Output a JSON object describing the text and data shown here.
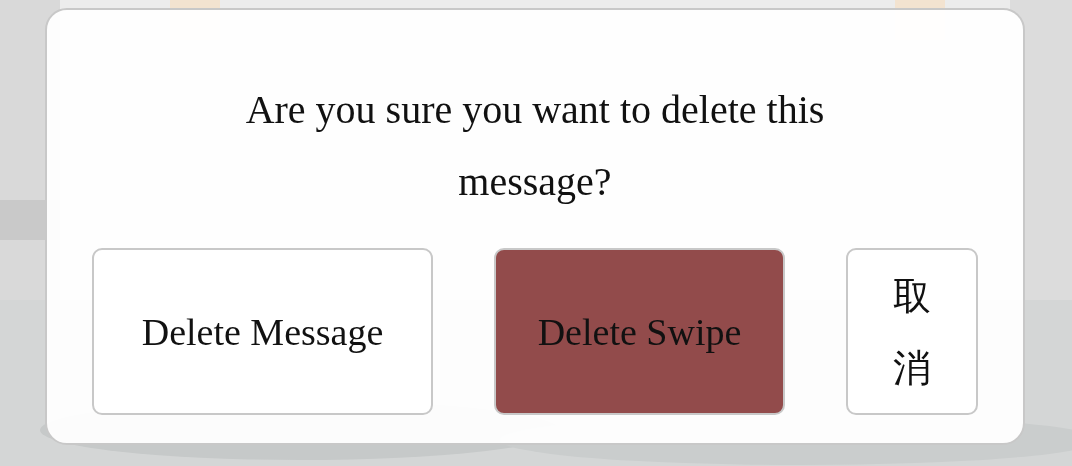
{
  "dialog": {
    "message": "Are you sure you want to delete this message?",
    "buttons": [
      {
        "label": "Delete Message",
        "selected": false
      },
      {
        "label": "Delete Swipe",
        "selected": true
      },
      {
        "label": "取消",
        "selected": false
      }
    ]
  }
}
